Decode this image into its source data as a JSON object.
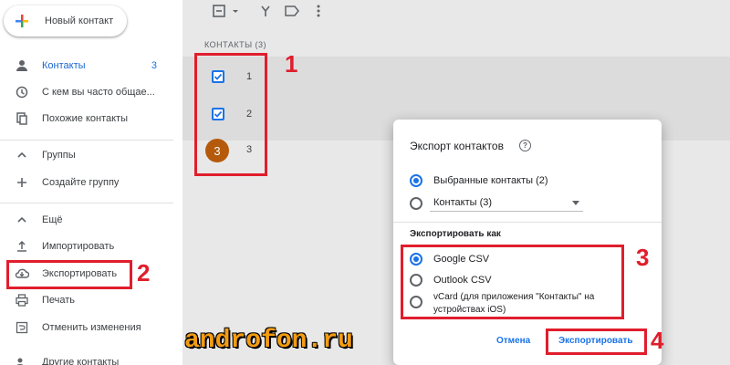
{
  "sidebar": {
    "new_contact_label": "Новый контакт",
    "items": [
      {
        "label": "Контакты",
        "count": "3",
        "icon": "person-icon"
      },
      {
        "label": "С кем вы часто общае...",
        "icon": "history-icon"
      },
      {
        "label": "Похожие контакты",
        "icon": "copy-icon"
      },
      {
        "label": "Группы",
        "icon": "chevron-up-icon"
      },
      {
        "label": "Создайте группу",
        "icon": "plus-icon"
      },
      {
        "label": "Ещё",
        "icon": "chevron-up-icon"
      },
      {
        "label": "Импортировать",
        "icon": "upload-icon"
      },
      {
        "label": "Экспортировать",
        "icon": "cloud-download-icon"
      },
      {
        "label": "Печать",
        "icon": "print-icon"
      },
      {
        "label": "Отменить изменения",
        "icon": "restore-icon"
      },
      {
        "label": "Другие контакты",
        "icon": "people-icon"
      }
    ]
  },
  "main": {
    "contacts_header": "КОНТАКТЫ (3)",
    "contacts": [
      {
        "name": "1",
        "checked": true
      },
      {
        "name": "2",
        "checked": true
      },
      {
        "name": "3",
        "avatar": "3"
      }
    ]
  },
  "dialog": {
    "title": "Экспорт контактов",
    "help_glyph": "?",
    "scope_options": [
      {
        "label": "Выбранные контакты (2)",
        "selected": true
      },
      {
        "label": "Контакты (3)",
        "selected": false
      }
    ],
    "format_label": "Экспортировать как",
    "format_options": [
      {
        "label": "Google CSV",
        "selected": true
      },
      {
        "label": "Outlook CSV",
        "selected": false
      },
      {
        "label": "vCard (для приложения \"Контакты\" на устройствах iOS)",
        "selected": false
      }
    ],
    "cancel_label": "Отмена",
    "export_label": "Экспортировать"
  },
  "annotations": {
    "label_1": "1",
    "label_2": "2",
    "label_3": "3",
    "label_4": "4",
    "color": "#e01e2c"
  },
  "watermark": "androfon.ru",
  "colors": {
    "accent": "#1a73e8",
    "avatar": "#b55a0b",
    "annotation": "#e01e2c",
    "watermark": "#f39c12"
  }
}
